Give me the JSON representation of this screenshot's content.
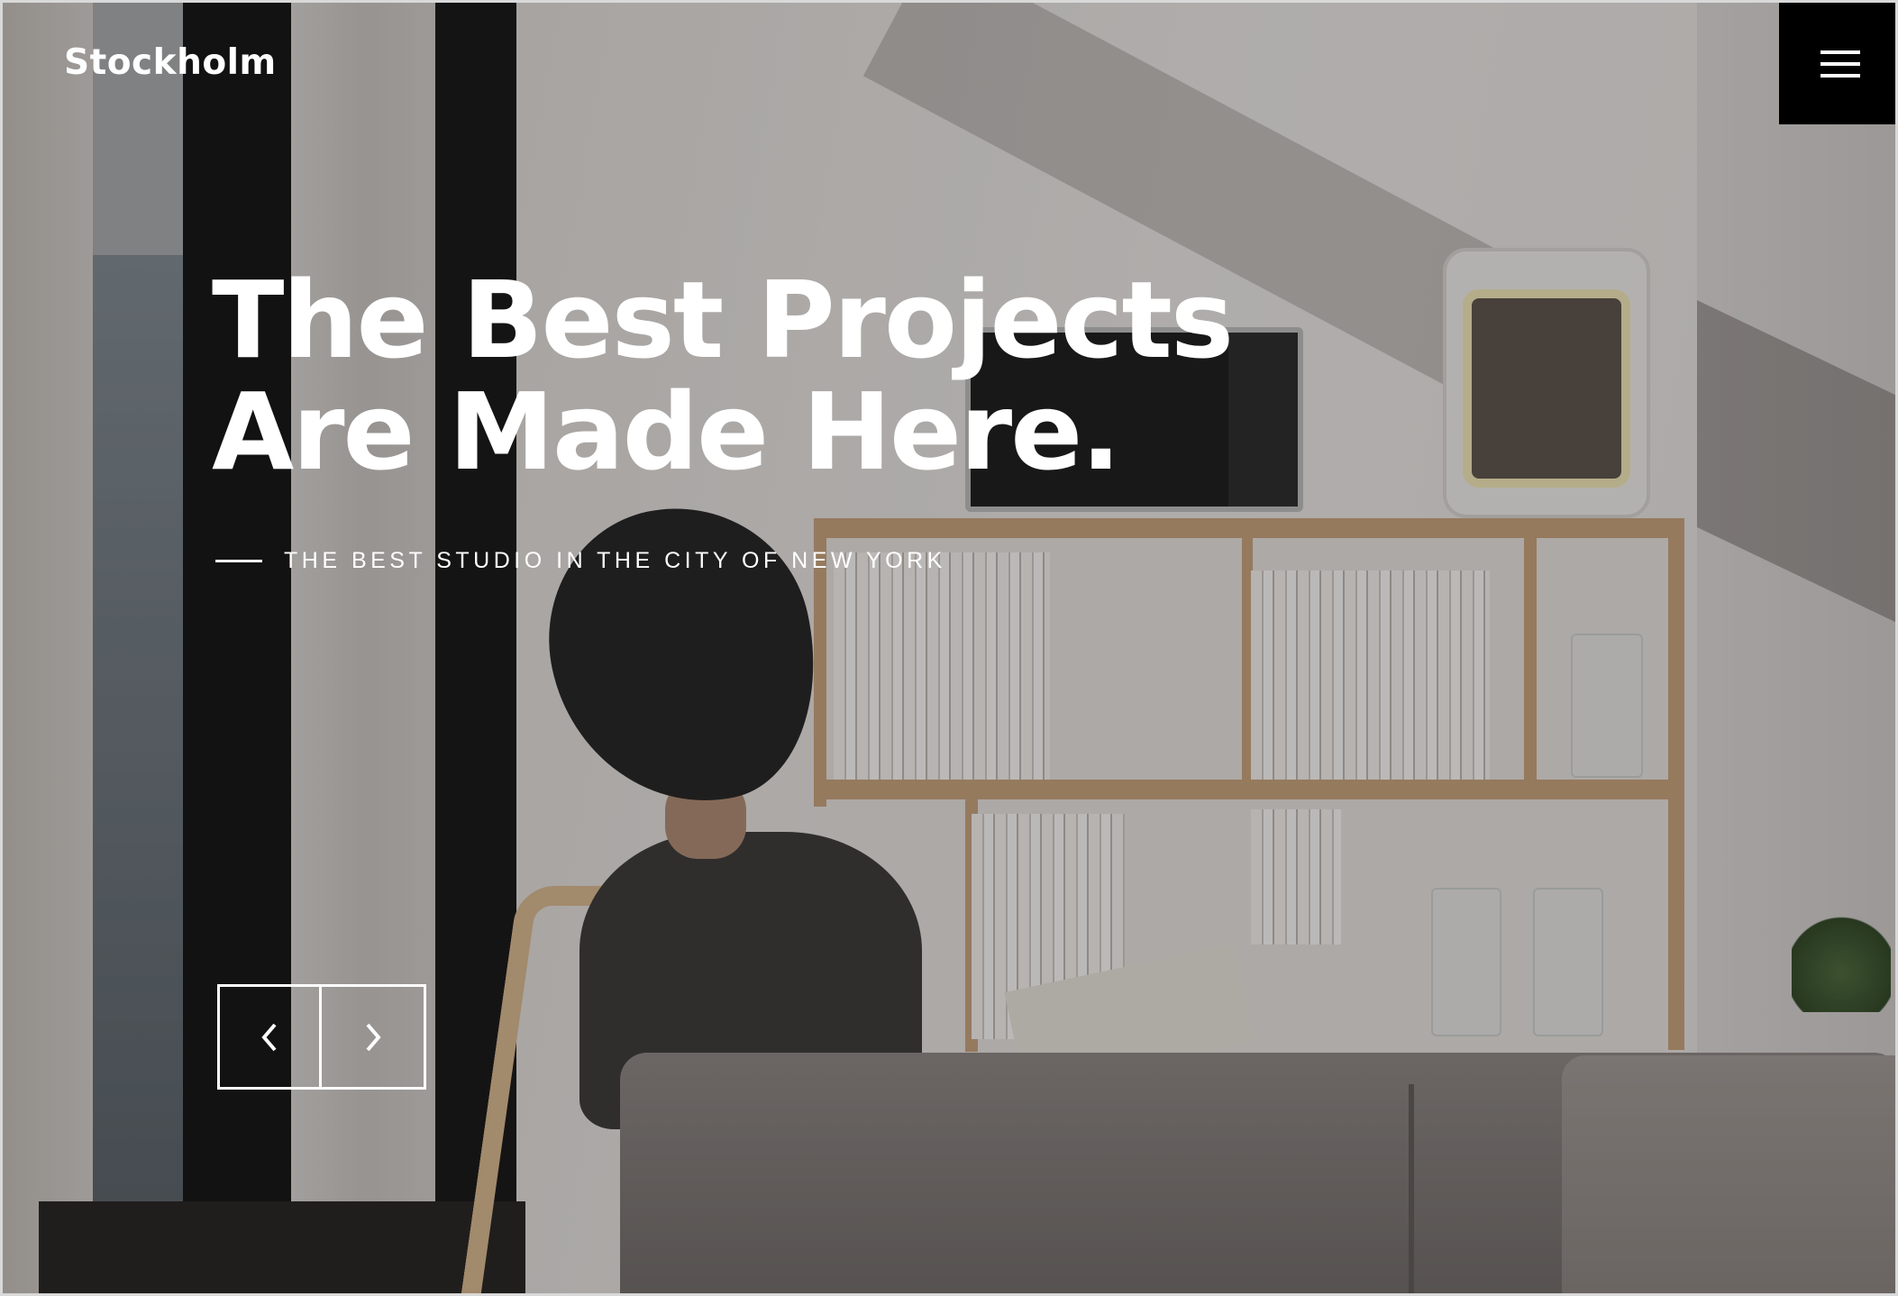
{
  "header": {
    "logo": "Stockholm",
    "menu_icon": "hamburger-menu-icon"
  },
  "hero": {
    "title_line1": "The Best Projects",
    "title_line2": "Are Made Here.",
    "subtitle": "THE BEST STUDIO IN THE CITY OF NEW YORK"
  },
  "slider": {
    "prev_icon": "chevron-left-icon",
    "next_icon": "chevron-right-icon"
  },
  "colors": {
    "text": "#ffffff",
    "menu_background": "#000000"
  }
}
